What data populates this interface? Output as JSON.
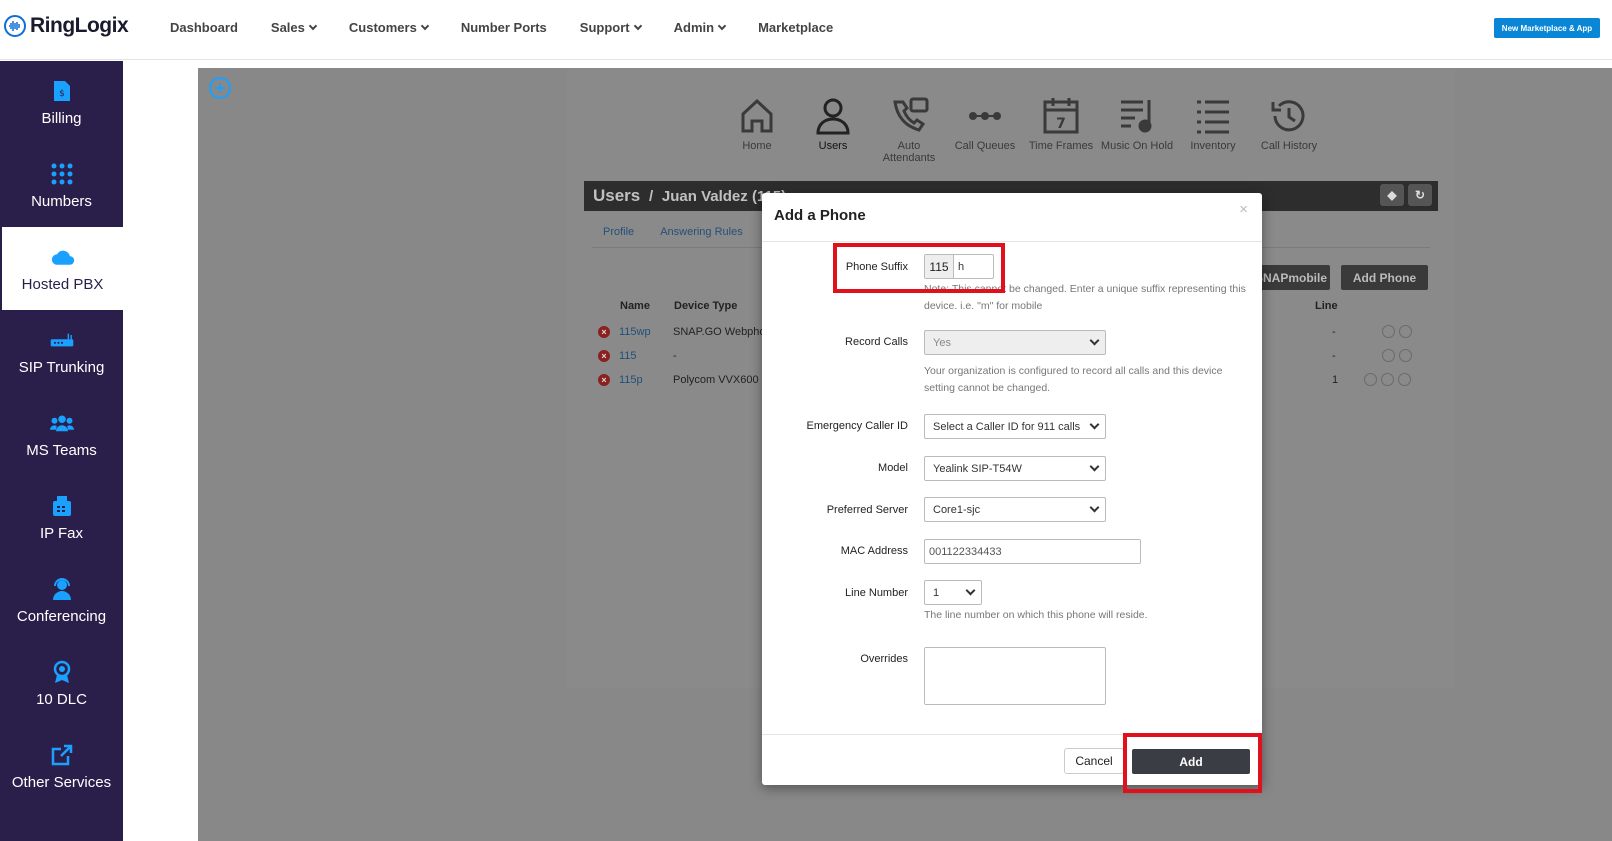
{
  "brand": {
    "name": "RingLogix"
  },
  "nav": {
    "items": [
      {
        "label": "Dashboard",
        "dropdown": false
      },
      {
        "label": "Sales",
        "dropdown": true
      },
      {
        "label": "Customers",
        "dropdown": true
      },
      {
        "label": "Number Ports",
        "dropdown": false
      },
      {
        "label": "Support",
        "dropdown": true
      },
      {
        "label": "Admin",
        "dropdown": true
      },
      {
        "label": "Marketplace",
        "dropdown": false
      }
    ],
    "marketplace_button": "New Marketplace & App"
  },
  "sidebar": {
    "items": [
      {
        "label": "Billing",
        "icon": "billing-icon"
      },
      {
        "label": "Numbers",
        "icon": "numbers-grid-icon"
      },
      {
        "label": "Hosted PBX",
        "icon": "cloud-phone-icon",
        "active": true
      },
      {
        "label": "SIP Trunking",
        "icon": "sip-trunk-icon"
      },
      {
        "label": "MS Teams",
        "icon": "teams-people-icon"
      },
      {
        "label": "IP Fax",
        "icon": "fax-icon"
      },
      {
        "label": "Conferencing",
        "icon": "conference-icon"
      },
      {
        "label": "10 DLC",
        "icon": "badge-icon"
      },
      {
        "label": "Other Services",
        "icon": "external-link-icon"
      }
    ]
  },
  "pbx_tabs": [
    {
      "label": "Home",
      "icon": "home-icon"
    },
    {
      "label": "Users",
      "icon": "user-icon",
      "active": true
    },
    {
      "label": "Auto Attendants",
      "icon": "auto-attendant-icon"
    },
    {
      "label": "Call Queues",
      "icon": "call-queues-icon"
    },
    {
      "label": "Time Frames",
      "icon": "calendar-icon"
    },
    {
      "label": "Music On Hold",
      "icon": "music-icon"
    },
    {
      "label": "Inventory",
      "icon": "list-icon"
    },
    {
      "label": "Call History",
      "icon": "history-icon"
    }
  ],
  "user_header": {
    "section": "Users",
    "separator": "/",
    "name": "Juan Valdez (115)"
  },
  "subtabs": [
    "Profile",
    "Answering Rules"
  ],
  "panel_buttons": {
    "snapmobile": "SNAPmobile",
    "add_phone": "Add Phone"
  },
  "table": {
    "headers": {
      "name": "Name",
      "device_type": "Device Type",
      "line": "Line"
    },
    "rows": [
      {
        "name": "115wp",
        "device_type": "SNAP.GO Webphone",
        "line": "-"
      },
      {
        "name": "115",
        "device_type": "-",
        "line": "-"
      },
      {
        "name": "115p",
        "device_type": "Polycom VVX600",
        "line": "1"
      }
    ]
  },
  "modal": {
    "title": "Add a Phone",
    "close": "×",
    "phone_suffix": {
      "label": "Phone Suffix",
      "prefix": "115",
      "value": "h",
      "help": "Note: This cannot be changed. Enter a unique suffix representing this device. i.e. \"m\" for mobile"
    },
    "record_calls": {
      "label": "Record Calls",
      "value": "Yes",
      "help": "Your organization is configured to record all calls and this device setting cannot be changed."
    },
    "emergency_caller_id": {
      "label": "Emergency Caller ID",
      "value": "Select a Caller ID for 911 calls"
    },
    "model": {
      "label": "Model",
      "value": "Yealink SIP-T54W"
    },
    "preferred_server": {
      "label": "Preferred Server",
      "value": "Core1-sjc"
    },
    "mac_address": {
      "label": "MAC Address",
      "value": "001122334433"
    },
    "line_number": {
      "label": "Line Number",
      "value": "1",
      "help": "The line number on which this phone will reside."
    },
    "overrides": {
      "label": "Overrides",
      "value": ""
    },
    "cancel": "Cancel",
    "add": "Add"
  }
}
